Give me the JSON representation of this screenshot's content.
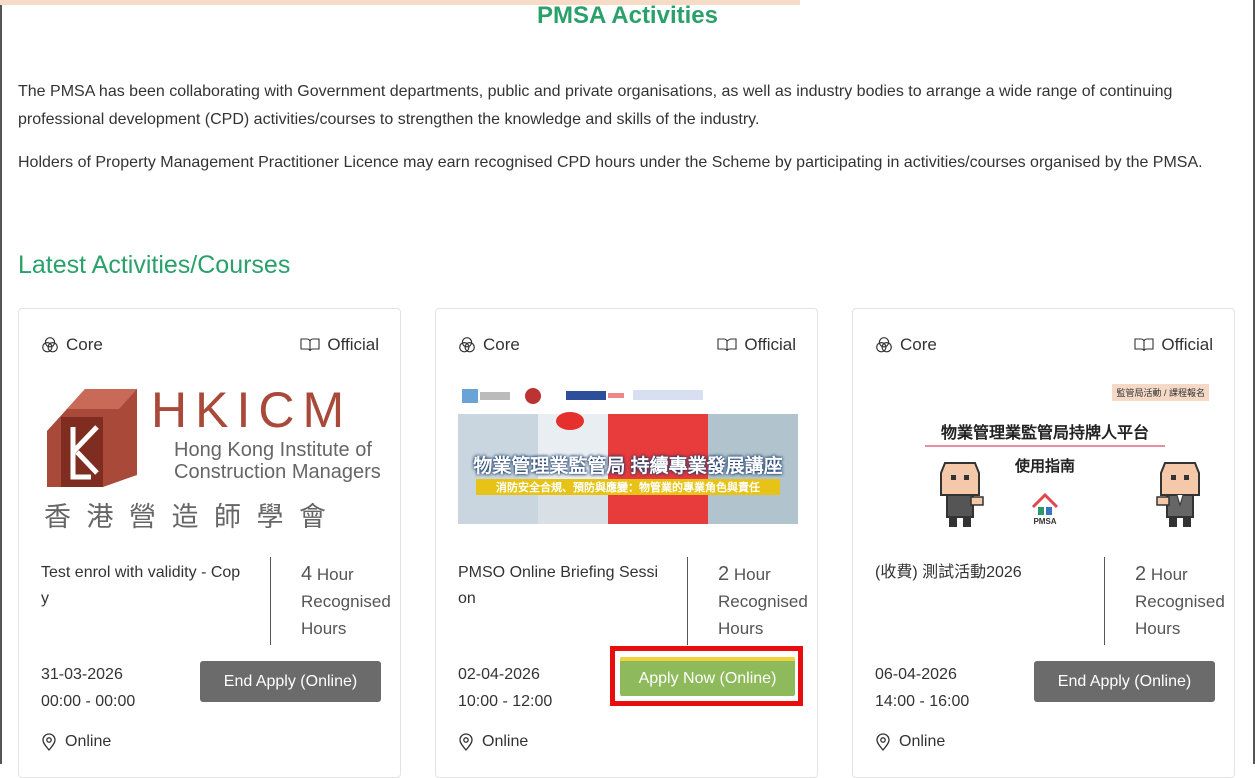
{
  "page": {
    "title": "PMSA Activities",
    "intro_p1": "The PMSA has been collaborating with Government departments, public and private organisations, as well as industry bodies to arrange a wide range of continuing professional development (CPD) activities/courses to strengthen the knowledge and skills of the industry.",
    "intro_p2": "Holders of Property Management Practitioner Licence may earn recognised CPD hours under the Scheme by participating in activities/courses organised by the PMSA.",
    "section_title": "Latest Activities/Courses"
  },
  "colors": {
    "accent_green": "#2aa06a",
    "apply_button": "#8fba5b",
    "end_button": "#6b6b6b",
    "highlight_red": "#e80e0e"
  },
  "cards": [
    {
      "category": "Core",
      "type": "Official",
      "title": "Test enrol with validity - Copy",
      "hours_num": "4",
      "hours_unit": "Hour",
      "hours_label1": "Recognised",
      "hours_label2": "Hours",
      "date": "31-03-2026",
      "time": "00:00 - 00:00",
      "button": "End Apply (Online)",
      "location": "Online",
      "banner": {
        "logo_text": "HKICM",
        "line1": "Hong Kong Institute of",
        "line2": "Construction Managers",
        "chinese": "香 港 營 造 師 學 會"
      }
    },
    {
      "category": "Core",
      "type": "Official",
      "title": "PMSO Online Briefing Session",
      "hours_num": "2",
      "hours_unit": "Hour",
      "hours_label1": "Recognised",
      "hours_label2": "Hours",
      "date": "02-04-2026",
      "time": "10:00 - 12:00",
      "button": "Apply Now (Online)",
      "location": "Online",
      "banner": {
        "headline": "物業管理業監管局 持續專業發展講座",
        "subline": "消防安全合規、預防與應變：物管業的專業角色與責任"
      }
    },
    {
      "category": "Core",
      "type": "Official",
      "title": "(收費) 測試活動2026",
      "hours_num": "2",
      "hours_unit": "Hour",
      "hours_label1": "Recognised",
      "hours_label2": "Hours",
      "date": "06-04-2026",
      "time": "14:00 - 16:00",
      "button": "End Apply (Online)",
      "location": "Online",
      "banner": {
        "badge": "監管局活動 / 課程報名",
        "headline": "物業管理業監管局持牌人平台",
        "subline": "使用指南",
        "logo": "PMSA"
      }
    }
  ]
}
